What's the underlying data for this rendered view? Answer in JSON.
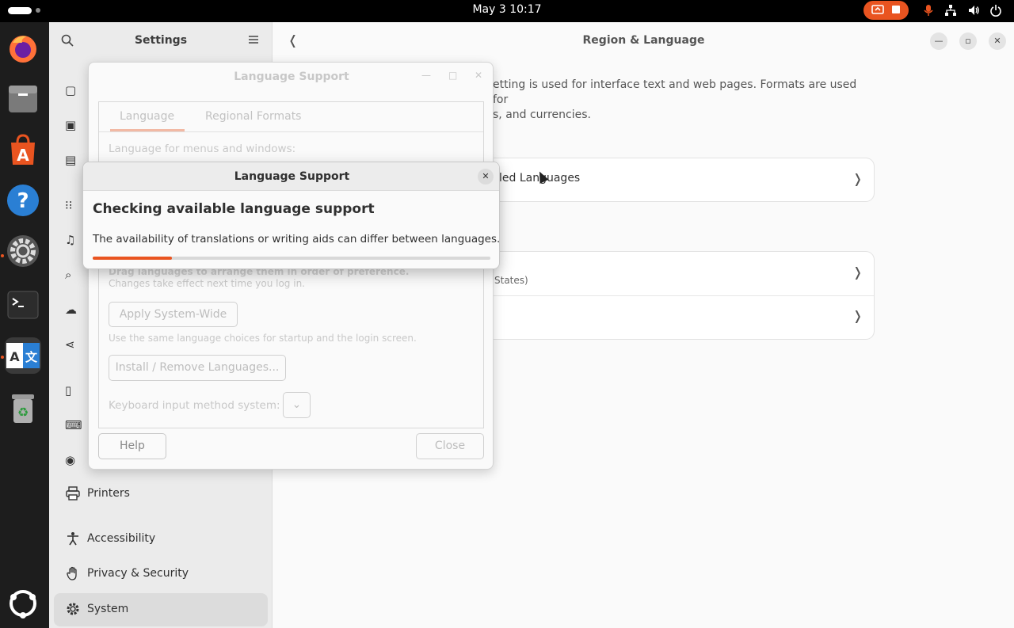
{
  "topbar": {
    "clock": "May 3  10:17",
    "icons": [
      "screen-share-icon",
      "stop-recording-icon",
      "microphone-icon",
      "network-icon",
      "volume-icon",
      "power-icon"
    ],
    "accent": "#e95420"
  },
  "dock": {
    "apps": [
      "firefox-icon",
      "files-icon",
      "app-center-icon",
      "help-icon",
      "settings-icon",
      "terminal-icon",
      "language-support-icon",
      "trash-icon",
      "show-apps-icon"
    ]
  },
  "settings": {
    "sidebar_title": "Settings",
    "sidebar_items": [
      {
        "label": "Printers",
        "icon": "printer-icon"
      },
      {
        "label": "Accessibility",
        "icon": "accessibility-icon"
      },
      {
        "label": "Privacy & Security",
        "icon": "hand-icon"
      },
      {
        "label": "System",
        "icon": "system-gear-icon"
      }
    ],
    "main_title": "Region & Language",
    "description_line1": "etting is used for interface text and web pages. Formats are used for",
    "description_line2": "s, and currencies.",
    "row_languages": "led Languages",
    "row_formats_sub": "States)"
  },
  "lang_support_bg": {
    "title": "Language Support",
    "tabs": [
      "Language",
      "Regional Formats"
    ],
    "menus_label": "Language for menus and windows:",
    "drag_hint": "Drag languages to arrange them in order of preference.",
    "changes_hint": "Changes take effect next time you log in.",
    "apply_button": "Apply System-Wide",
    "apply_hint": "Use the same language choices for startup and the login screen.",
    "install_button": "Install / Remove Languages...",
    "keyboard_label": "Keyboard input method system:",
    "help_button": "Help",
    "close_button": "Close"
  },
  "lang_support_progress": {
    "title": "Language Support",
    "heading": "Checking available language support",
    "body": "The availability of translations or writing aids can differ between languages.",
    "progress": 0.2
  }
}
